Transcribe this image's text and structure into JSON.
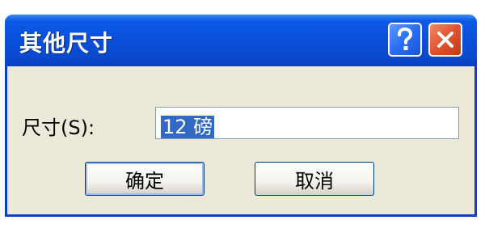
{
  "window": {
    "title": "其他尺寸",
    "help_icon": "question-mark-icon",
    "close_icon": "close-x-icon",
    "accent_color": "#0a4fd9"
  },
  "form": {
    "size_label": "尺寸(S):",
    "size_value": "12 磅"
  },
  "buttons": {
    "ok_label": "确定",
    "cancel_label": "取消"
  }
}
